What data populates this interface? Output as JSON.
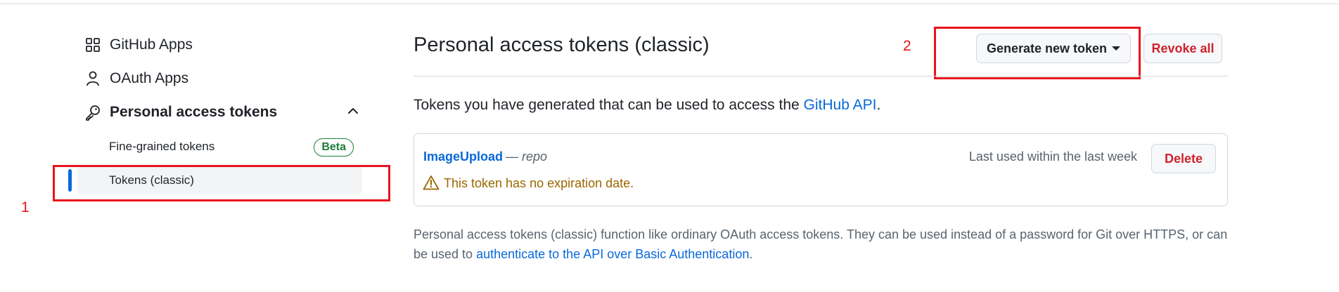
{
  "sidebar": {
    "items": [
      {
        "label": "GitHub Apps",
        "icon": "apps-grid-icon"
      },
      {
        "label": "OAuth Apps",
        "icon": "person-icon"
      },
      {
        "label": "Personal access tokens",
        "icon": "key-icon",
        "expanded": true
      }
    ],
    "sub_items": [
      {
        "label": "Fine-grained tokens",
        "badge": "Beta"
      },
      {
        "label": "Tokens (classic)",
        "active": true
      }
    ]
  },
  "annotations": {
    "one": "1",
    "two": "2"
  },
  "main": {
    "title": "Personal access tokens (classic)",
    "generate_button": "Generate new token",
    "revoke_button": "Revoke all",
    "intro_text": "Tokens you have generated that can be used to access the ",
    "intro_link": "GitHub API",
    "intro_end": ".",
    "token": {
      "name": "ImageUpload",
      "scope_text": "— repo",
      "last_used": "Last used within the last week",
      "delete_button": "Delete",
      "warning": "This token has no expiration date."
    },
    "footer_text": "Personal access tokens (classic) function like ordinary OAuth access tokens. They can be used instead of a password for Git over HTTPS, or can be used to ",
    "footer_link": "authenticate to the API over Basic Authentication",
    "footer_end": "."
  },
  "colors": {
    "accent": "#0969da",
    "danger": "#cf222e",
    "success": "#1a7f37",
    "warning": "#9a6700",
    "annotation": "#e8141c"
  }
}
